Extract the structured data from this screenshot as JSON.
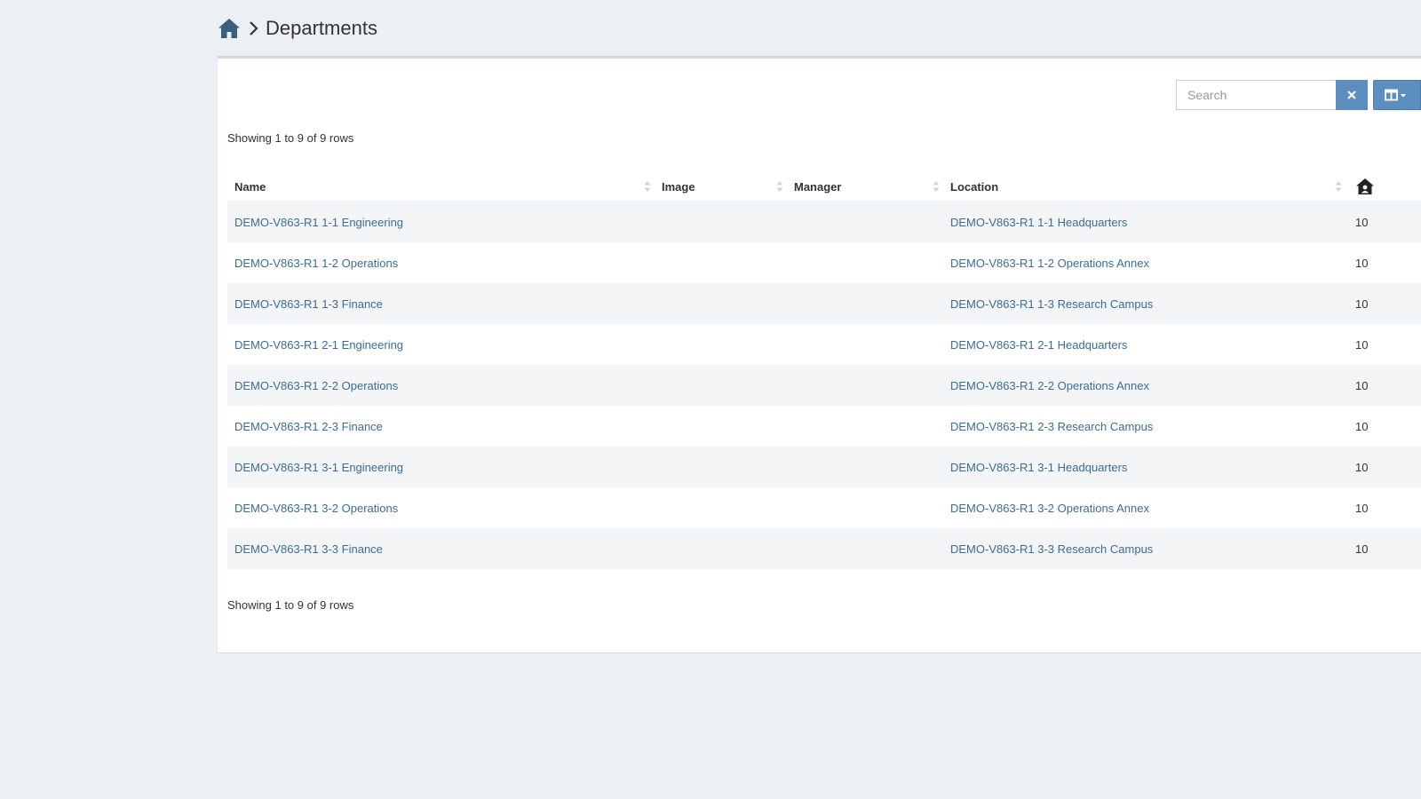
{
  "breadcrumb": {
    "home_icon": "home-icon",
    "separator_icon": "chevron-right-icon",
    "title": "Departments"
  },
  "toolbar": {
    "search_placeholder": "Search",
    "search_value": "",
    "clear_icon": "close-icon",
    "columns_icon": "columns-icon"
  },
  "pagination": {
    "top_text": "Showing 1 to 9 of 9 rows",
    "bottom_text": "Showing 1 to 9 of 9 rows"
  },
  "table": {
    "headers": {
      "name": "Name",
      "image": "Image",
      "manager": "Manager",
      "location": "Location",
      "count_icon": "users-house-icon"
    },
    "rows": [
      {
        "name": "DEMO-V863-R1 1-1 Engineering",
        "image": "",
        "manager": "",
        "location": "DEMO-V863-R1 1-1 Headquarters",
        "count": "10"
      },
      {
        "name": "DEMO-V863-R1 1-2 Operations",
        "image": "",
        "manager": "",
        "location": "DEMO-V863-R1 1-2 Operations Annex",
        "count": "10"
      },
      {
        "name": "DEMO-V863-R1 1-3 Finance",
        "image": "",
        "manager": "",
        "location": "DEMO-V863-R1 1-3 Research Campus",
        "count": "10"
      },
      {
        "name": "DEMO-V863-R1 2-1 Engineering",
        "image": "",
        "manager": "",
        "location": "DEMO-V863-R1 2-1 Headquarters",
        "count": "10"
      },
      {
        "name": "DEMO-V863-R1 2-2 Operations",
        "image": "",
        "manager": "",
        "location": "DEMO-V863-R1 2-2 Operations Annex",
        "count": "10"
      },
      {
        "name": "DEMO-V863-R1 2-3 Finance",
        "image": "",
        "manager": "",
        "location": "DEMO-V863-R1 2-3 Research Campus",
        "count": "10"
      },
      {
        "name": "DEMO-V863-R1 3-1 Engineering",
        "image": "",
        "manager": "",
        "location": "DEMO-V863-R1 3-1 Headquarters",
        "count": "10"
      },
      {
        "name": "DEMO-V863-R1 3-2 Operations",
        "image": "",
        "manager": "",
        "location": "DEMO-V863-R1 3-2 Operations Annex",
        "count": "10"
      },
      {
        "name": "DEMO-V863-R1 3-3 Finance",
        "image": "",
        "manager": "",
        "location": "DEMO-V863-R1 3-3 Research Campus",
        "count": "10"
      }
    ]
  },
  "colors": {
    "background": "#ecf0f5",
    "link": "#3c6c96",
    "button": "#5c8fc0",
    "home_icon": "#3d5d7e"
  }
}
